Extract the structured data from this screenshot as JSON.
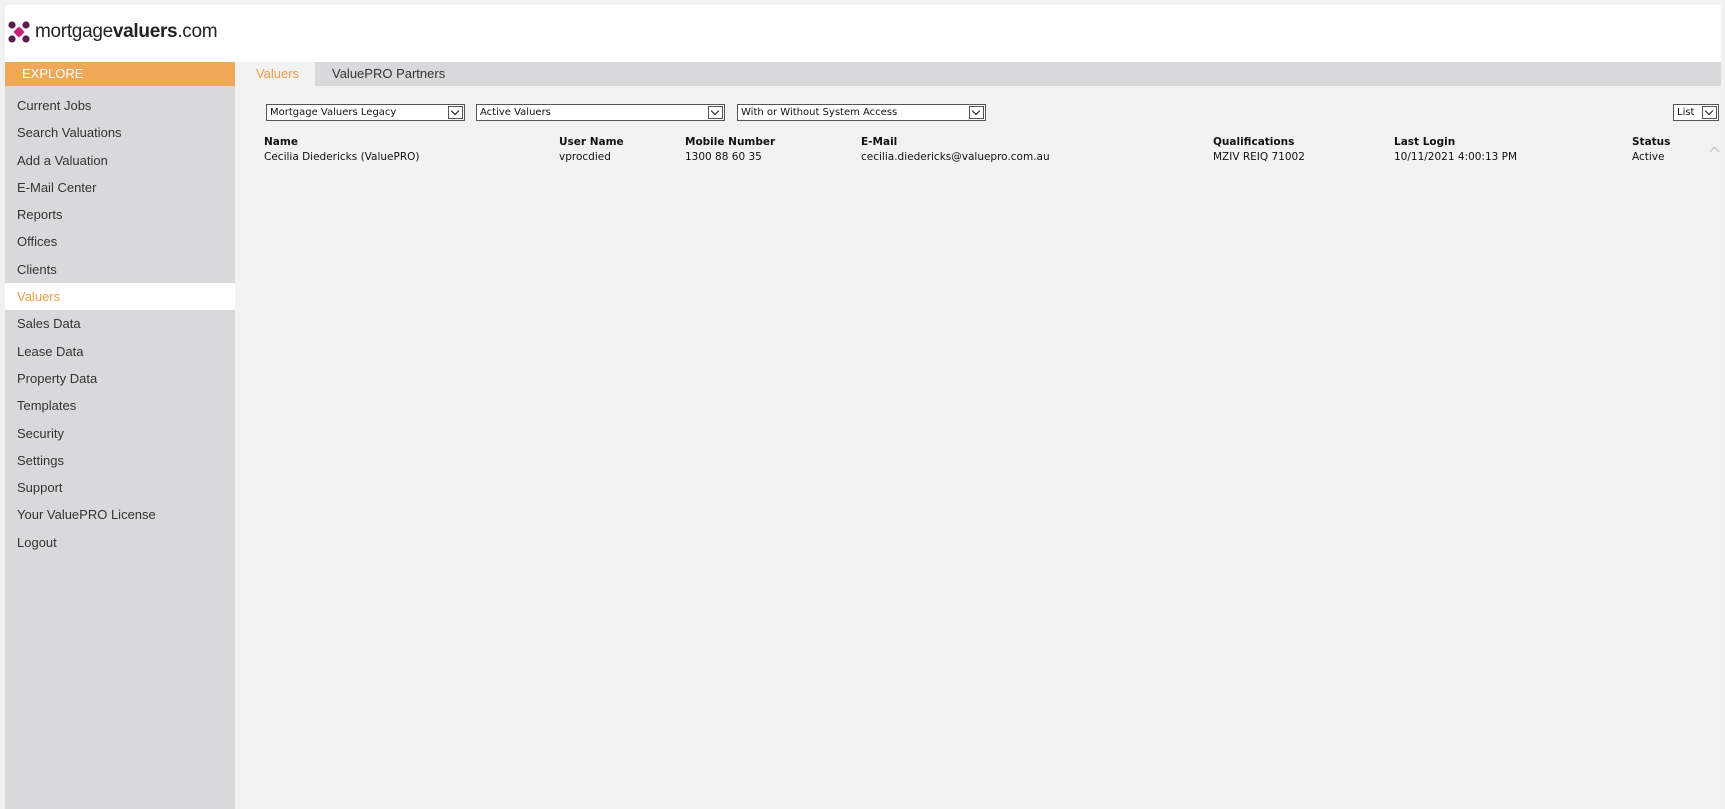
{
  "brand": {
    "logo_text_light": "mortgage",
    "logo_text_bold": "valuers",
    "logo_text_suffix": ".com",
    "accent_color": "#efa758",
    "logo_icon": "x-cross-logo-icon"
  },
  "sidebar": {
    "header": "EXPLORE",
    "items": [
      {
        "label": "Current Jobs"
      },
      {
        "label": "Search Valuations"
      },
      {
        "label": "Add a Valuation"
      },
      {
        "label": "E-Mail Center"
      },
      {
        "label": "Reports"
      },
      {
        "label": "Offices"
      },
      {
        "label": "Clients"
      },
      {
        "label": "Valuers",
        "active": true
      },
      {
        "label": "Sales Data"
      },
      {
        "label": "Lease Data"
      },
      {
        "label": "Property Data"
      },
      {
        "label": "Templates"
      },
      {
        "label": "Security"
      },
      {
        "label": "Settings"
      },
      {
        "label": "Support"
      },
      {
        "label": "Your ValuePRO License"
      },
      {
        "label": "Logout"
      }
    ]
  },
  "tabs": [
    {
      "label": "Valuers",
      "active": true
    },
    {
      "label": "ValuePRO Partners",
      "active": false
    }
  ],
  "filters": {
    "company": "Mortgage Valuers Legacy",
    "status": "Active Valuers",
    "access": "With or Without System Access",
    "view": "List"
  },
  "table": {
    "columns": [
      "Name",
      "User Name",
      "Mobile Number",
      "E-Mail",
      "Qualifications",
      "Last Login",
      "Status"
    ],
    "rows": [
      [
        "Cecilia Diedericks (ValuePRO)",
        "vprocdied",
        "1300 88 60 35",
        "cecilia.diedericks@valuepro.com.au",
        "MZIV REIQ 71002",
        "10/11/2021 4:00:13 PM",
        "Active"
      ]
    ]
  }
}
